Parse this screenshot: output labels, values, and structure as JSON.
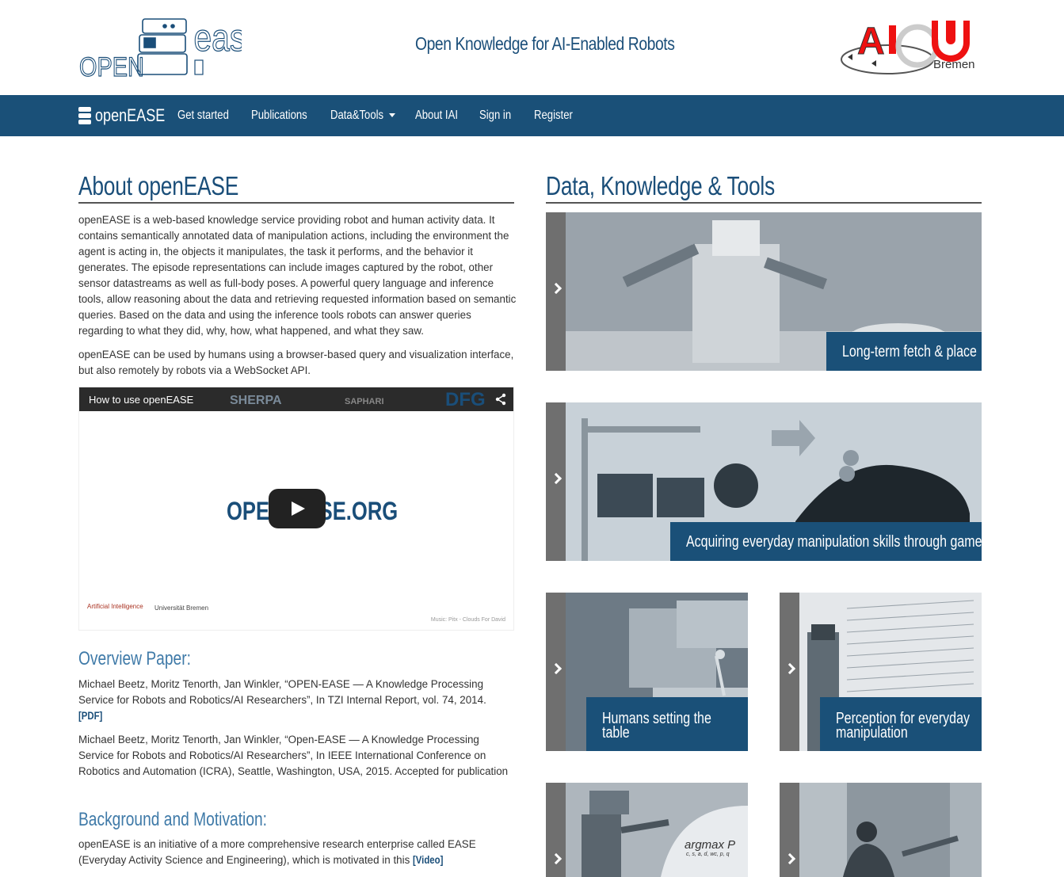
{
  "header": {
    "tagline": "Open Knowledge for AI-Enabled Robots",
    "logo_left": {
      "top_right_text": "ease",
      "bottom_left_text": "OPEN"
    },
    "logo_right": {
      "text_ai": "AI",
      "text_city": "Bremen"
    }
  },
  "navbar": {
    "brand": "openEASE",
    "items": [
      {
        "label": "Get started"
      },
      {
        "label": "Publications"
      },
      {
        "label": "Data&Tools"
      },
      {
        "label": "About IAI"
      },
      {
        "label": "Sign in"
      },
      {
        "label": "Register"
      }
    ]
  },
  "about": {
    "title": "About openEASE",
    "para1": "openEASE is a web-based knowledge service providing robot and human activity data. It contains semantically annotated data of manipulation actions, including the environment the agent is acting in, the objects it manipulates, the task it performs, and the behavior it generates. The episode representations can include images captured by the robot, other sensor datastreams as well as full-body poses. A powerful query language and inference tools, allow reasoning about the data and retrieving requested information based on semantic queries. Based on the data and using the inference tools robots can answer queries regarding to what they did, why, how, what happened, and what they saw.",
    "para2": "openEASE can be used by humans using a browser-based query and visualization interface, but also remotely by robots via a WebSocket API."
  },
  "video": {
    "title": "How to use openEASE",
    "logo_text": "OPEN-EASE.ORG",
    "sponsors": [
      "SHERPA",
      "SAPHARI",
      "DFG"
    ],
    "footer_ai": "Artificial Intelligence",
    "footer_uni": "Universität Bremen",
    "footer_music": "Music: Pitx - Clouds For David"
  },
  "overview": {
    "title": "Overview Paper:",
    "ref1": "Michael Beetz, Moritz Tenorth, Jan Winkler, “OPEN-EASE — A Knowledge Processing Service for Robots and Robotics/AI Researchers”, In TZI Internal Report, vol. 74, 2014.",
    "ref1_link": "[PDF]",
    "ref2": "Michael Beetz, Moritz Tenorth, Jan Winkler, “Open-EASE — A Knowledge Processing Service for Robots and Robotics/AI Researchers”, In IEEE International Conference on Robotics and Automation (ICRA), Seattle, Washington, USA, 2015. Accepted for publication"
  },
  "background": {
    "title": "Background and Motivation:",
    "text": "openEASE is an initiative of a more comprehensive research enterprise called EASE (Everyday Activity Science and Engineering), which is motivated in this",
    "link": "[Video]"
  },
  "data_tools": {
    "title": "Data, Knowledge & Tools",
    "tiles": [
      {
        "caption": "Long-term fetch & place"
      },
      {
        "caption": "Acquiring everyday manipulation skills through games"
      },
      {
        "caption_line1": "Humans setting the",
        "caption_line2": "table"
      },
      {
        "caption_line1": "Perception for everyday",
        "caption_line2": "manipulation"
      },
      {
        "overlay": "argmax P",
        "overlay_sub": "c, s, a, d, wc, p, q"
      },
      {
        "caption": ""
      }
    ]
  }
}
